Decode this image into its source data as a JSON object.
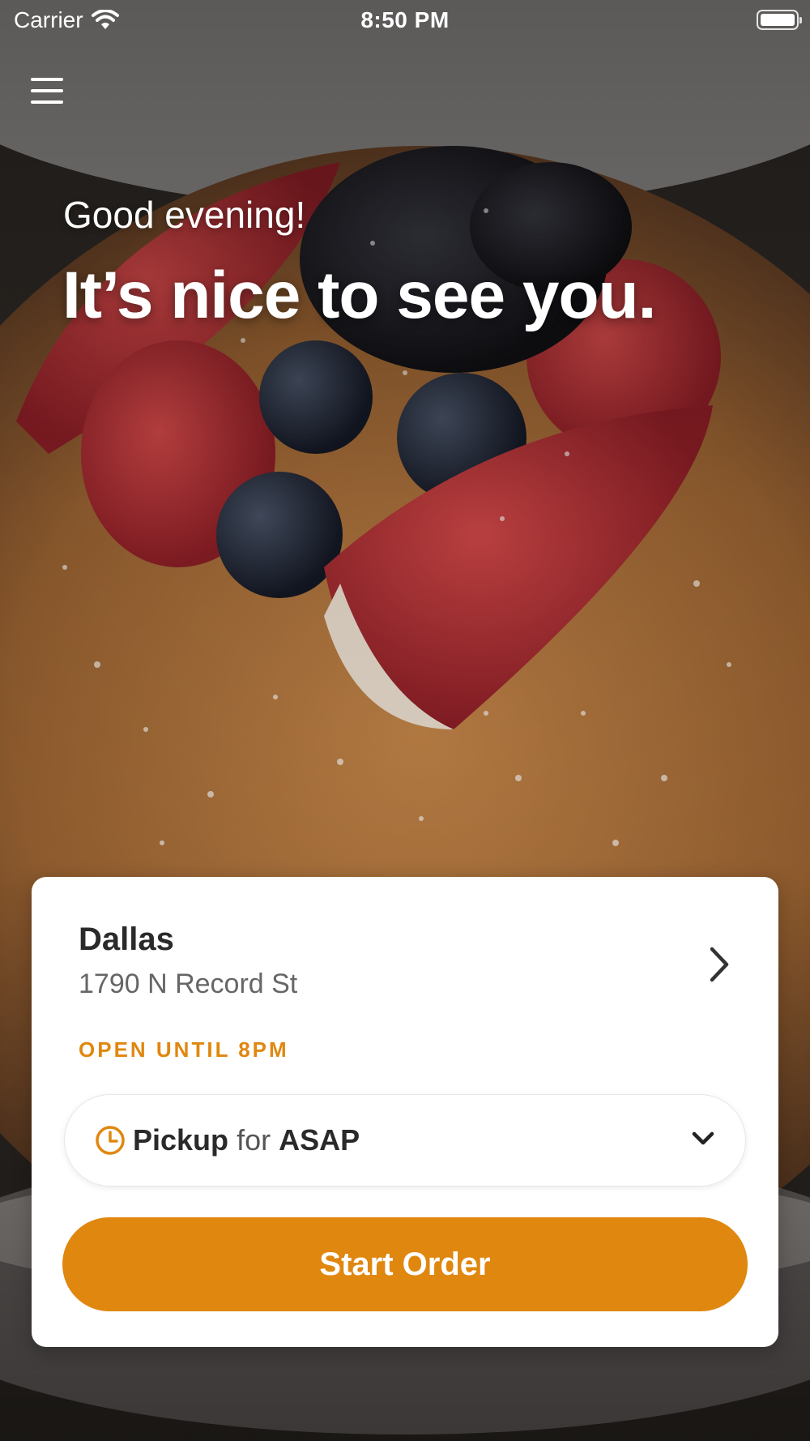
{
  "status_bar": {
    "carrier": "Carrier",
    "time": "8:50 PM"
  },
  "hero": {
    "greeting": "Good evening!",
    "headline": "It’s nice to see you."
  },
  "location": {
    "name": "Dallas",
    "address": "1790 N Record St",
    "hours": "OPEN UNTIL 8PM"
  },
  "order": {
    "mode": "Pickup",
    "connector": "for",
    "time": "ASAP",
    "start_label": "Start Order"
  },
  "colors": {
    "accent": "#e0870f"
  },
  "icons": [
    "wifi-icon",
    "battery-icon",
    "menu-icon",
    "chevron-right-icon",
    "clock-icon",
    "chevron-down-icon"
  ]
}
